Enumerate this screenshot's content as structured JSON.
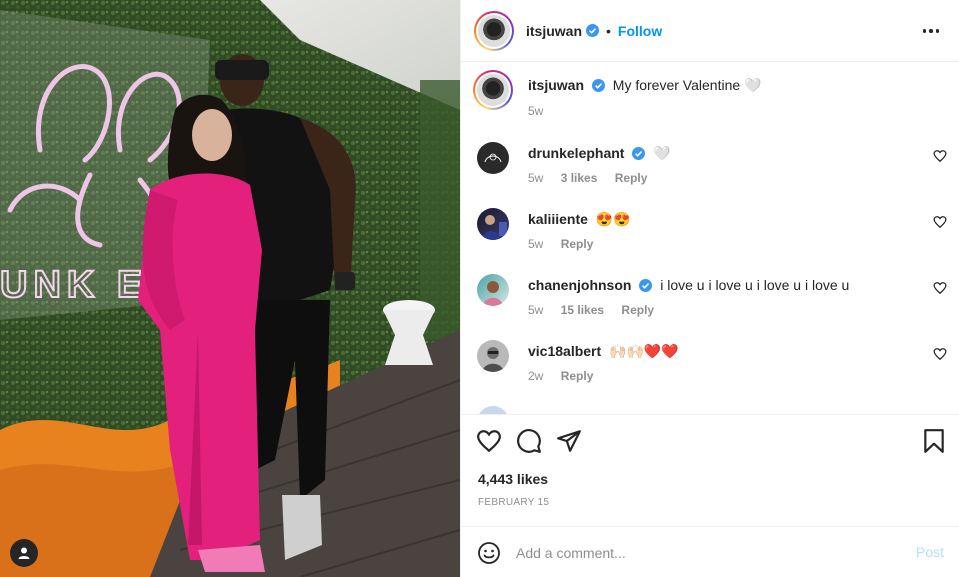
{
  "post": {
    "author": "itsjuwan",
    "follow_label": "Follow",
    "dot": "•",
    "caption": "My forever Valentine 🤍",
    "caption_age": "5w",
    "likes": "4,443 likes",
    "date": "FEBRUARY 15",
    "photo_sign_text": "UNK EL"
  },
  "comments": [
    {
      "user": "drunkelephant",
      "verified": true,
      "text": "🤍",
      "age": "5w",
      "likes": "3 likes",
      "reply": "Reply"
    },
    {
      "user": "kaliiiente",
      "verified": false,
      "text": "😍😍",
      "age": "5w",
      "likes": "",
      "reply": "Reply"
    },
    {
      "user": "chanenjohnson",
      "verified": true,
      "text": "i love u i love u i love u i love u",
      "age": "5w",
      "likes": "15 likes",
      "reply": "Reply"
    },
    {
      "user": "vic18albert",
      "verified": false,
      "text": "🙌🏻🙌🏻❤️❤️",
      "age": "2w",
      "likes": "",
      "reply": "Reply"
    }
  ],
  "composer": {
    "placeholder": "Add a comment...",
    "post_label": "Post"
  },
  "icons": {
    "more": "more-options-icon",
    "like": "heart-icon",
    "comment": "comment-icon",
    "share": "share-icon",
    "save": "bookmark-icon",
    "emoji": "emoji-icon",
    "verified": "verified-badge-icon",
    "photo_user": "user-tag-icon"
  },
  "colors": {
    "accent": "#0095f6",
    "verified": "#3897f0",
    "muted": "#8e8e8e",
    "post_disabled": "#b2dffc"
  }
}
